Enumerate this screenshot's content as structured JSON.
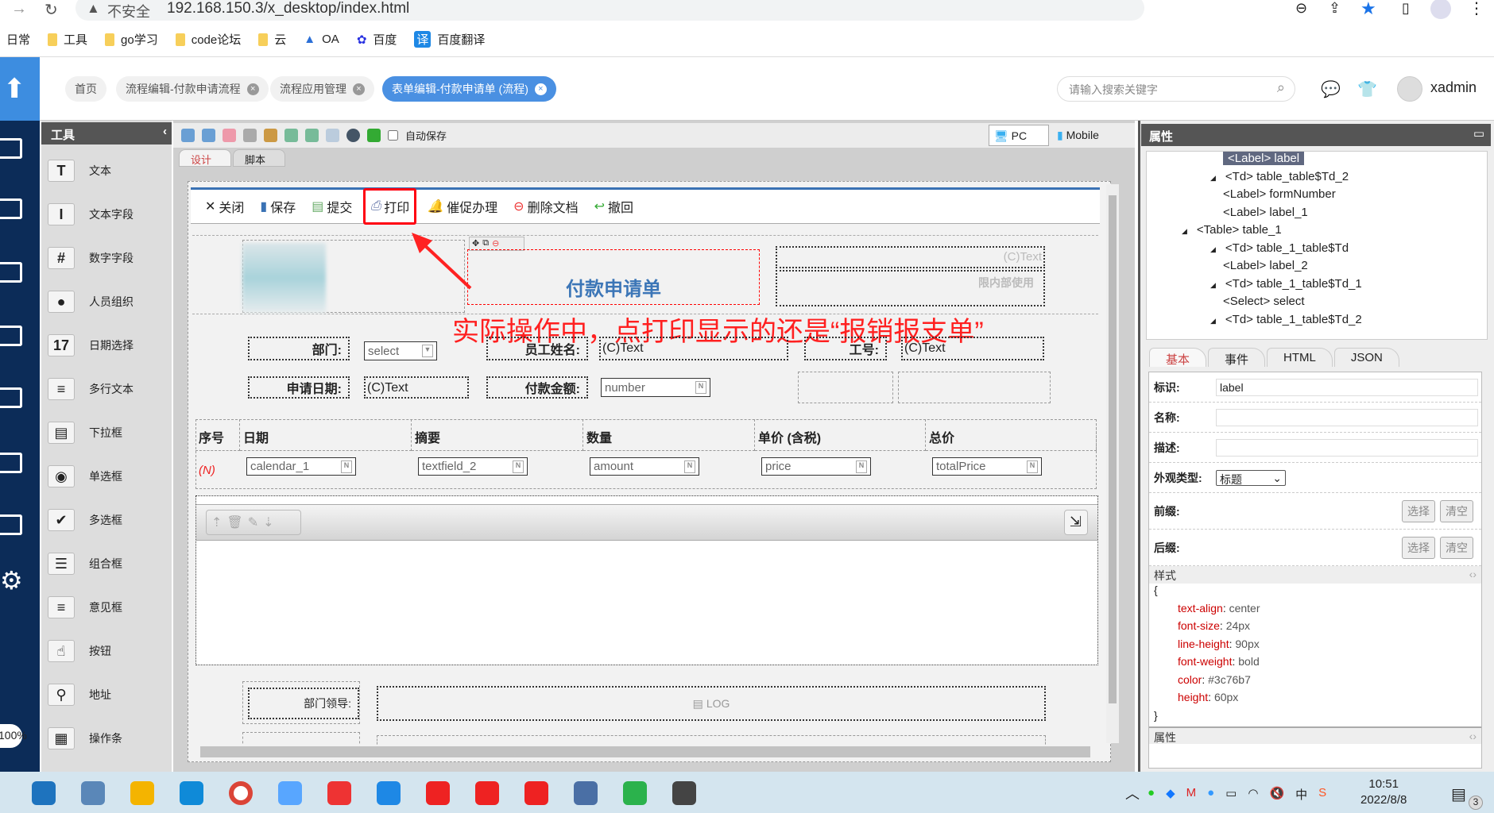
{
  "browser": {
    "security": "不安全",
    "url": "192.168.150.3/x_desktop/index.html",
    "bookmarks": [
      "日常",
      "工具",
      "go学习",
      "code论坛",
      "云",
      "OA",
      "百度",
      "百度翻译"
    ]
  },
  "header": {
    "tabs": [
      {
        "label": "首页"
      },
      {
        "label": "流程编辑-付款申请流程"
      },
      {
        "label": "流程应用管理"
      },
      {
        "label": "表单编辑-付款申请单 (流程)"
      }
    ],
    "search_placeholder": "请输入搜索关键字",
    "username": "xadmin"
  },
  "nav": {
    "zoom": "100%"
  },
  "tools": {
    "title": "工具",
    "items": [
      {
        "label": "文本",
        "icon": "T"
      },
      {
        "label": "文本字段",
        "icon": "I"
      },
      {
        "label": "数字字段",
        "icon": "#"
      },
      {
        "label": "人员组织",
        "icon": "●"
      },
      {
        "label": "日期选择",
        "icon": "17"
      },
      {
        "label": "多行文本",
        "icon": "≡"
      },
      {
        "label": "下拉框",
        "icon": "▤"
      },
      {
        "label": "单选框",
        "icon": "◉"
      },
      {
        "label": "多选框",
        "icon": "✔"
      },
      {
        "label": "组合框",
        "icon": "☰"
      },
      {
        "label": "意见框",
        "icon": "≡"
      },
      {
        "label": "按钮",
        "icon": "☝"
      },
      {
        "label": "地址",
        "icon": "⚲"
      },
      {
        "label": "操作条",
        "icon": "▦"
      }
    ]
  },
  "toolbar": {
    "autosave": "自动保存",
    "pc": "PC",
    "mobile": "Mobile"
  },
  "design_tabs": [
    "设计",
    "脚本"
  ],
  "form": {
    "actions": [
      "关闭",
      "保存",
      "提交",
      "打印",
      "催促办理",
      "删除文档",
      "撤回"
    ],
    "title": "付款申请单",
    "ctext": "(C)Text",
    "internal": "限内部使用",
    "annotation": "实际操作中，点打印显示的还是“报销报支单”",
    "row1": {
      "dept_label": "部门:",
      "dept_value": "select",
      "name_label": "员工姓名:",
      "name_value": "(C)Text",
      "id_label": "工号:",
      "id_value": "(C)Text"
    },
    "row2": {
      "date_label": "申请日期:",
      "date_value": "(C)Text",
      "amount_label": "付款金额:",
      "amount_value": "number"
    },
    "table": {
      "headers": [
        "序号",
        "日期",
        "摘要",
        "数量",
        "单价 (含税)",
        "总价"
      ],
      "row": [
        "(N)",
        "calendar_1",
        "textfield_2",
        "amount",
        "price",
        "totalPrice"
      ]
    },
    "leader_label": "部门领导:",
    "log": "LOG"
  },
  "props": {
    "title": "属性",
    "tree": [
      {
        "t": "<Label> label",
        "lvl": 3,
        "sel": true
      },
      {
        "t": "<Td> table_table$Td_2",
        "lvl": 2
      },
      {
        "t": "<Label> formNumber",
        "lvl": 3
      },
      {
        "t": "<Label> label_1",
        "lvl": 3
      },
      {
        "t": "<Table> table_1",
        "lvl": 1
      },
      {
        "t": "<Td> table_1_table$Td",
        "lvl": 2
      },
      {
        "t": "<Label> label_2",
        "lvl": 3
      },
      {
        "t": "<Td> table_1_table$Td_1",
        "lvl": 2
      },
      {
        "t": "<Select> select",
        "lvl": 3
      },
      {
        "t": "<Td> table_1_table$Td_2",
        "lvl": 2
      }
    ],
    "tabs": [
      "基本",
      "事件",
      "HTML",
      "JSON"
    ],
    "id_label": "标识:",
    "id_value": "label",
    "name_label": "名称:",
    "desc_label": "描述:",
    "type_label": "外观类型:",
    "type_value": "标题",
    "prefix_label": "前缀:",
    "suffix_label": "后缀:",
    "choose": "选择",
    "clear": "清空",
    "style_title": "样式",
    "attr_title": "属性",
    "styles": [
      {
        "k": "text-align",
        "v": "center"
      },
      {
        "k": "font-size",
        "v": "24px"
      },
      {
        "k": "line-height",
        "v": "90px"
      },
      {
        "k": "font-weight",
        "v": "bold"
      },
      {
        "k": "color",
        "v": "#3c76b7"
      },
      {
        "k": "height",
        "v": "60px"
      }
    ]
  },
  "taskbar": {
    "time": "10:51",
    "date": "2022/8/8",
    "notifications": "3"
  },
  "colors": {
    "nav": "#0c2c58",
    "accent": "#4a90e2",
    "title": "#3c76b7",
    "annotation": "#ff2020"
  }
}
